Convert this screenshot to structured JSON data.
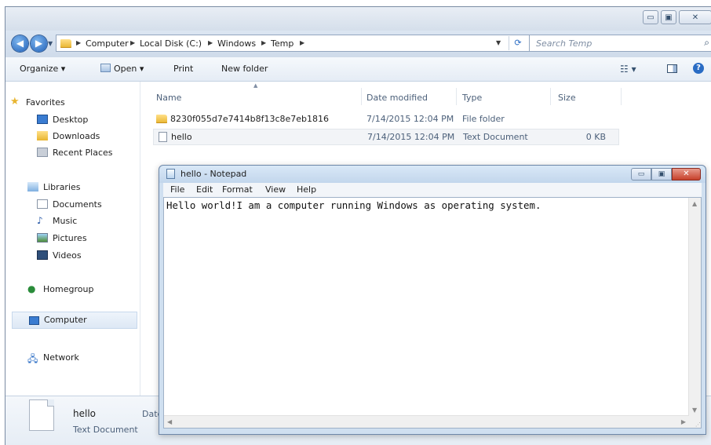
{
  "breadcrumbs": [
    "Computer",
    "Local Disk (C:)",
    "Windows",
    "Temp"
  ],
  "search": {
    "placeholder": "Search Temp"
  },
  "toolbar": {
    "organize": "Organize ▾",
    "open": "Open ▾",
    "print": "Print",
    "new_folder": "New folder"
  },
  "sidebar": {
    "favorites": {
      "label": "Favorites",
      "items": [
        "Desktop",
        "Downloads",
        "Recent Places"
      ]
    },
    "libraries": {
      "label": "Libraries",
      "items": [
        "Documents",
        "Music",
        "Pictures",
        "Videos"
      ]
    },
    "homegroup": "Homegroup",
    "computer": "Computer",
    "network": "Network"
  },
  "columns": {
    "name": "Name",
    "date": "Date modified",
    "type": "Type",
    "size": "Size"
  },
  "files": [
    {
      "name": "8230f055d7e7414b8f13c8e7eb1816",
      "date": "7/14/2015 12:04 PM",
      "type": "File folder",
      "size": ""
    },
    {
      "name": "hello",
      "date": "7/14/2015 12:04 PM",
      "type": "Text Document",
      "size": "0 KB"
    }
  ],
  "details": {
    "name": "hello",
    "type": "Text Document",
    "date_label": "Date"
  },
  "notepad": {
    "title": "hello - Notepad",
    "menu": [
      "File",
      "Edit",
      "Format",
      "View",
      "Help"
    ],
    "content": "Hello world!I am a computer running Windows as operating system."
  }
}
